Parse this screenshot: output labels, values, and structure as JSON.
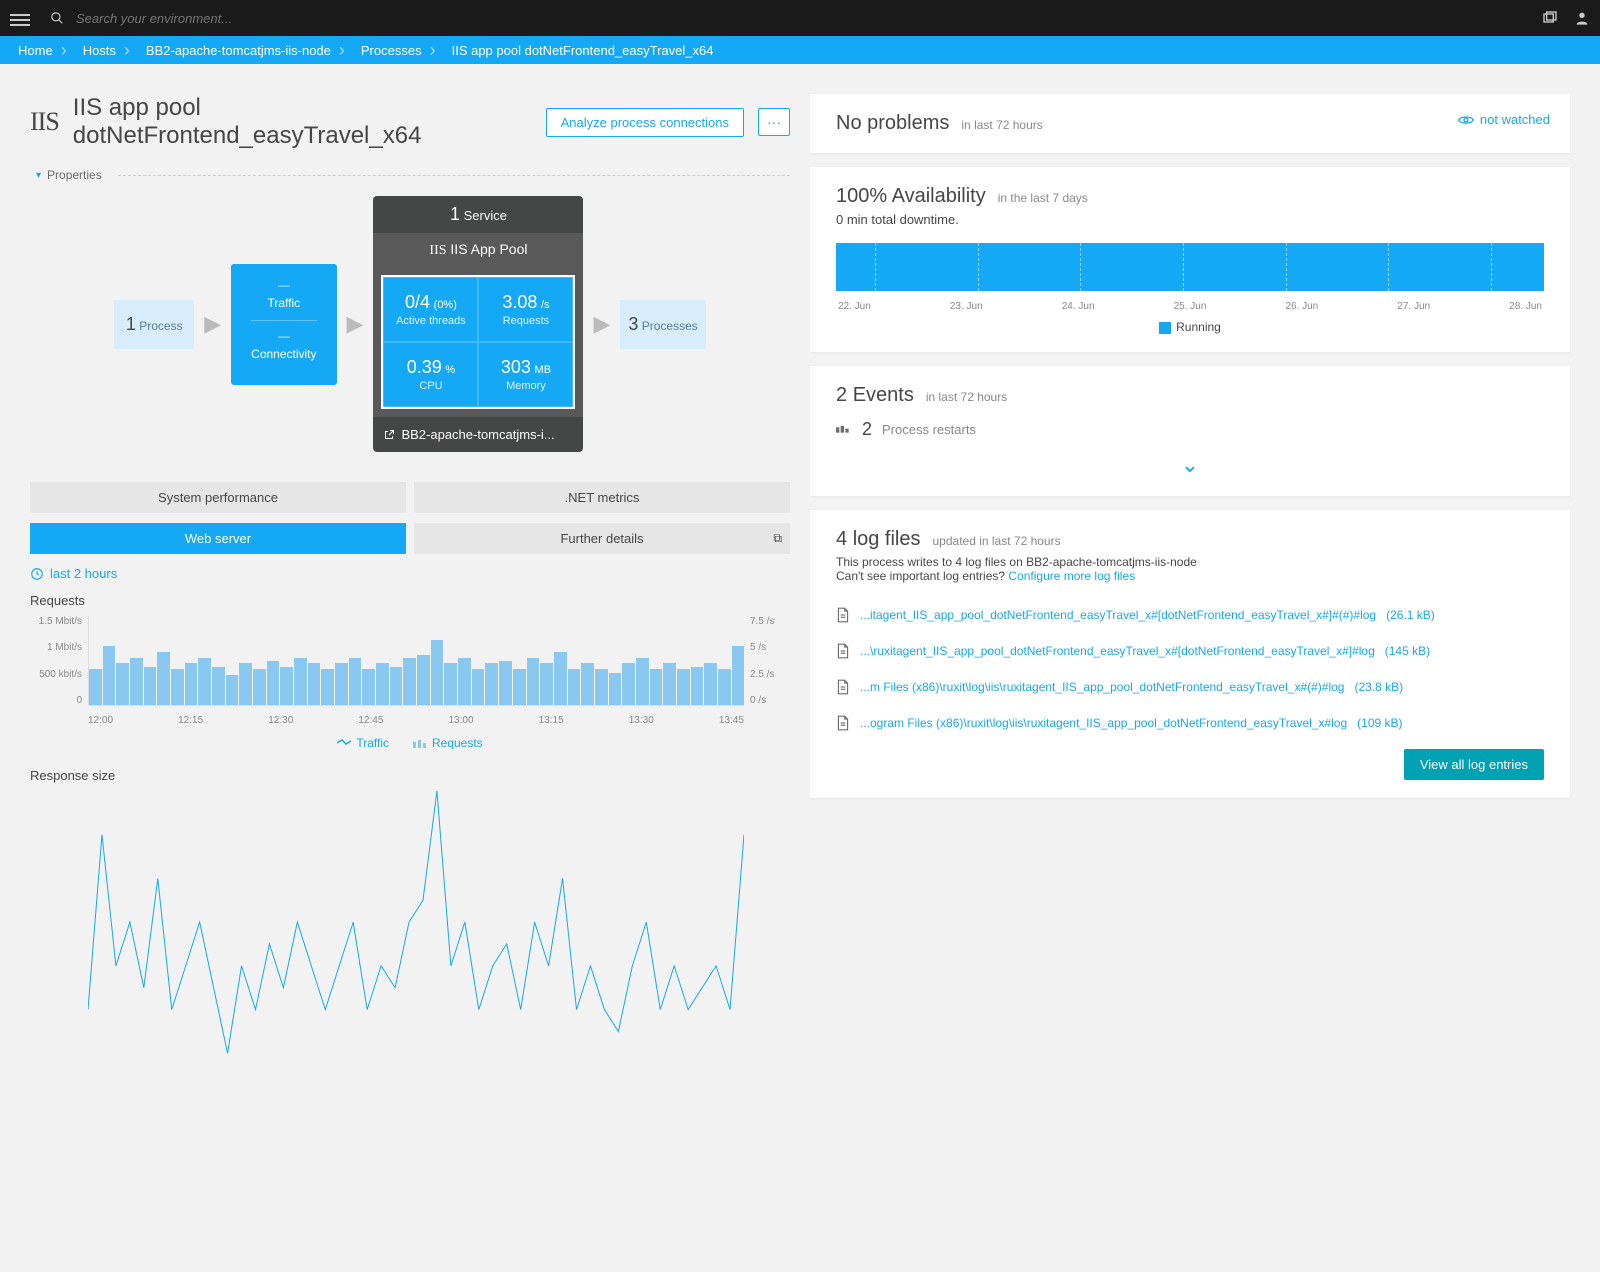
{
  "topbar": {
    "search_placeholder": "Search your environment..."
  },
  "breadcrumb": [
    "Home",
    "Hosts",
    "BB2-apache-tomcatjms-iis-node",
    "Processes",
    "IIS app pool dotNetFrontend_easyTravel_x64"
  ],
  "page": {
    "title": "IIS app pool dotNetFrontend_easyTravel_x64",
    "analyze_btn": "Analyze process connections",
    "more_btn": "···",
    "properties_label": "Properties"
  },
  "topology": {
    "left_box": {
      "num": "1",
      "label": "Process"
    },
    "traffic": {
      "dash1": "—",
      "label1": "Traffic",
      "dash2": "—",
      "label2": "Connectivity"
    },
    "card": {
      "top_num": "1",
      "top_label": "Service",
      "title": "IIS App Pool",
      "metrics": [
        {
          "val": "0/4",
          "unit": "(0%)",
          "lbl": "Active threads"
        },
        {
          "val": "3.08",
          "unit": "/s",
          "lbl": "Requests"
        },
        {
          "val": "0.39",
          "unit": "%",
          "lbl": "CPU"
        },
        {
          "val": "303",
          "unit": "MB",
          "lbl": "Memory"
        }
      ],
      "footer": "BB2-apache-tomcatjms-i..."
    },
    "right_box": {
      "num": "3",
      "label": "Processes"
    }
  },
  "tabs": {
    "row1": [
      "System performance",
      ".NET metrics"
    ],
    "row2": [
      "Web server",
      "Further details"
    ],
    "active": "Web server",
    "time_label": "last 2 hours"
  },
  "chart": {
    "title": "Requests",
    "y_left": [
      "1.5 Mbit/s",
      "1 Mbit/s",
      "500 kbit/s",
      "0"
    ],
    "y_right": [
      "7.5 /s",
      "5 /s",
      "2.5 /s",
      "0 /s"
    ],
    "x": [
      "12:00",
      "12:15",
      "12:30",
      "12:45",
      "13:00",
      "13:15",
      "13:30",
      "13:45"
    ],
    "legend": [
      "Traffic",
      "Requests"
    ],
    "next_title": "Response size"
  },
  "chart_data": {
    "type": "bar",
    "title": "Requests",
    "x_categories": [
      "12:00",
      "12:15",
      "12:30",
      "12:45",
      "13:00",
      "13:15",
      "13:30",
      "13:45"
    ],
    "series": [
      {
        "name": "Traffic",
        "unit": "Mbit/s",
        "axis": "left",
        "ylim": [
          0,
          1.5
        ],
        "values": [
          0.6,
          1.0,
          0.7,
          0.8,
          0.65,
          0.9,
          0.6,
          0.7,
          0.8,
          0.65,
          0.5,
          0.7,
          0.6,
          0.75,
          0.65,
          0.8,
          0.7,
          0.6,
          0.7,
          0.8,
          0.6,
          0.7,
          0.65,
          0.8,
          0.85,
          1.1,
          0.7,
          0.8,
          0.6,
          0.7,
          0.75,
          0.6,
          0.8,
          0.7,
          0.9,
          0.6,
          0.7,
          0.6,
          0.55,
          0.7,
          0.8,
          0.6,
          0.7,
          0.6,
          0.65,
          0.7,
          0.6,
          1.0
        ]
      },
      {
        "name": "Requests",
        "unit": "/s",
        "axis": "right",
        "ylim": [
          0,
          7.5
        ],
        "values": [
          3,
          5,
          3.5,
          4,
          3.2,
          4.5,
          3,
          3.5,
          4,
          3.2,
          2.5,
          3.5,
          3,
          3.7,
          3.2,
          4,
          3.5,
          3,
          3.5,
          4,
          3,
          3.5,
          3.2,
          4,
          4.2,
          5.5,
          3.5,
          4,
          3,
          3.5,
          3.7,
          3,
          4,
          3.5,
          4.5,
          3,
          3.5,
          3,
          2.7,
          3.5,
          4,
          3,
          3.5,
          3,
          3.2,
          3.5,
          3,
          5
        ]
      }
    ]
  },
  "problems": {
    "title": "No problems",
    "subtitle": "in last 72 hours",
    "watch": "not watched"
  },
  "availability": {
    "title": "100% Availability",
    "subtitle": "in the last 7 days",
    "downtime": "0 min total downtime.",
    "dates": [
      "22. Jun",
      "23. Jun",
      "24. Jun",
      "25. Jun",
      "26. Jun",
      "27. Jun",
      "28. Jun"
    ],
    "legend": "Running"
  },
  "events": {
    "title_num": "2",
    "title_label": "Events",
    "subtitle": "in last 72 hours",
    "item_num": "2",
    "item_label": "Process restarts"
  },
  "logs": {
    "title_num": "4",
    "title_label": "log files",
    "subtitle": "updated in last 72 hours",
    "desc1": "This process writes to 4 log files on BB2-apache-tomcatjms-iis-node",
    "desc2_prefix": "Can't see important log entries? ",
    "desc2_link": "Configure more log files",
    "files": [
      {
        "name": "...itagent_IIS_app_pool_dotNetFrontend_easyTravel_x#[dotNetFrontend_easyTravel_x#]#(#)#log",
        "size": "(26.1 kB)"
      },
      {
        "name": "...\\ruxitagent_IIS_app_pool_dotNetFrontend_easyTravel_x#[dotNetFrontend_easyTravel_x#]#log",
        "size": "(145 kB)"
      },
      {
        "name": "...m Files (x86)\\ruxit\\log\\iis\\ruxitagent_IIS_app_pool_dotNetFrontend_easyTravel_x#(#)#log",
        "size": "(23.8 kB)"
      },
      {
        "name": "...ogram Files (x86)\\ruxit\\log\\iis\\ruxitagent_IIS_app_pool_dotNetFrontend_easyTravel_x#log",
        "size": "(109 kB)"
      }
    ],
    "view_all": "View all log entries"
  }
}
